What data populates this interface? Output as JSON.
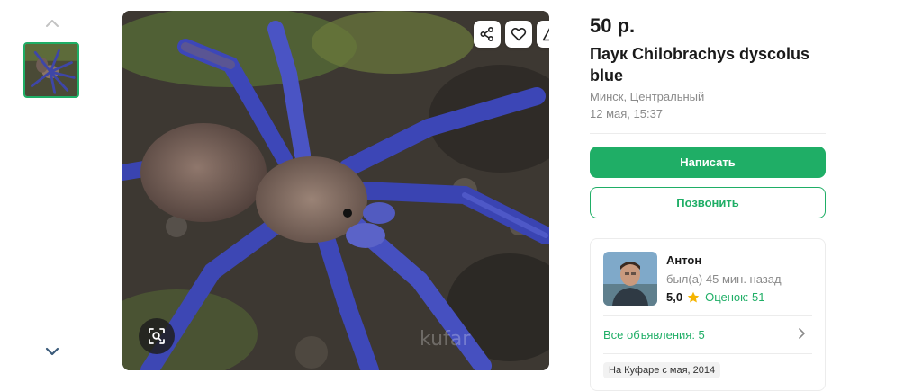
{
  "gallery": {
    "nav_up_icon": "chevron-up-icon",
    "nav_down_icon": "chevron-down-icon",
    "actions": [
      "share-icon",
      "heart-icon",
      "warning-icon"
    ],
    "lens_icon": "image-search-icon"
  },
  "listing": {
    "price": "50 р.",
    "title": "Паук Chilobrachys dyscolus blue",
    "location": "Минск, Центральный",
    "date": "12 мая, 15:37"
  },
  "buttons": {
    "write": "Написать",
    "call": "Позвонить"
  },
  "seller": {
    "name": "Антон",
    "last_seen": "был(а) 45 мин. назад",
    "rating": "5,0",
    "reviews": "Оценок: 51",
    "all_ads": "Все объявления: 5",
    "since": "На Куфаре с мая, 2014"
  },
  "colors": {
    "accent": "#1fae66",
    "muted_text": "#8a8a8a",
    "star": "#f5b400"
  }
}
